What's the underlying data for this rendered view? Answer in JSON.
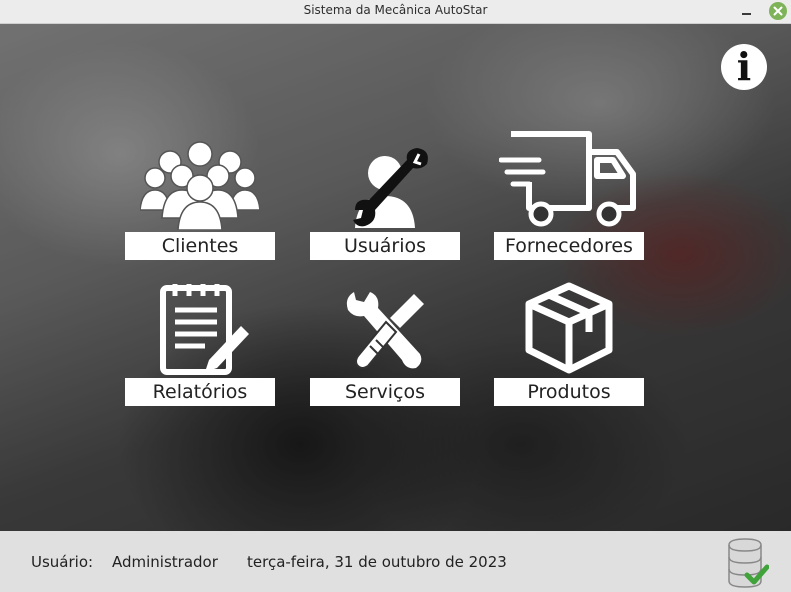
{
  "window": {
    "title": "Sistema da Mecânica AutoStar"
  },
  "info_button": {
    "icon": "info-icon",
    "glyph": "i"
  },
  "tiles": [
    {
      "label": "Clientes",
      "icon": "users-group-icon"
    },
    {
      "label": "Usuários",
      "icon": "user-wrench-icon"
    },
    {
      "label": "Fornecedores",
      "icon": "delivery-truck-icon"
    },
    {
      "label": "Relatórios",
      "icon": "report-clipboard-icon"
    },
    {
      "label": "Serviços",
      "icon": "wrench-screwdriver-icon"
    },
    {
      "label": "Produtos",
      "icon": "product-box-icon"
    }
  ],
  "status": {
    "user_label": "Usuário:",
    "user_value": "Administrador",
    "date": "terça-feira, 31 de outubro de 2023",
    "db_icon": "database-ok-icon"
  },
  "colors": {
    "close_button": "#7fb35a",
    "label_bg": "#ffffff",
    "status_bg": "#e0e0e0"
  }
}
